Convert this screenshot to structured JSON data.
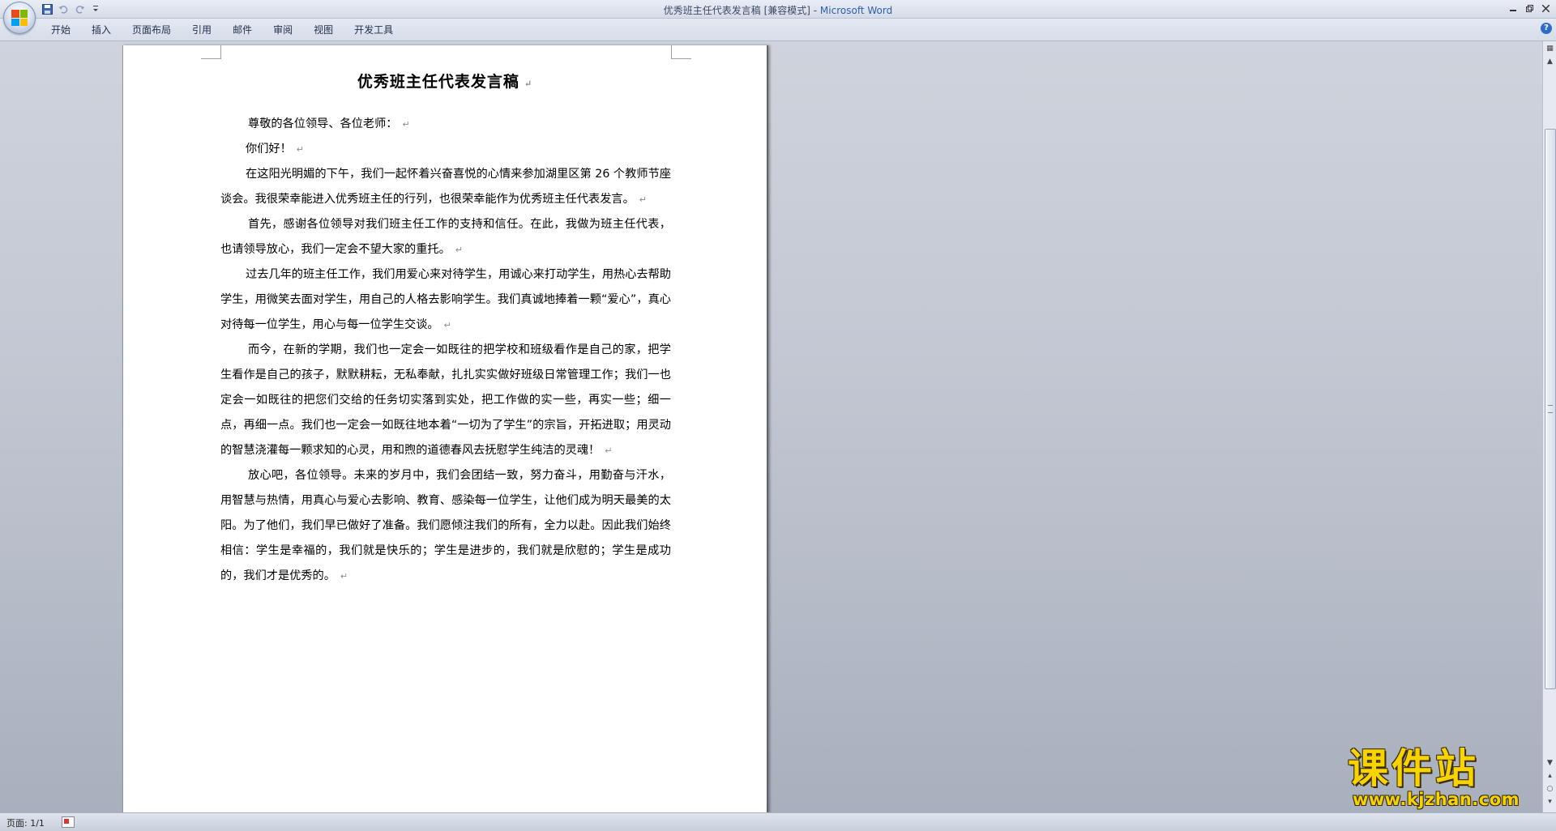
{
  "window": {
    "title_doc": "优秀班主任代表发言稿 [兼容模式] - ",
    "title_app": "Microsoft Word"
  },
  "ribbon": {
    "tabs": [
      "开始",
      "插入",
      "页面布局",
      "引用",
      "邮件",
      "审阅",
      "视图",
      "开发工具"
    ]
  },
  "document": {
    "title": "优秀班主任代表发言稿",
    "paragraphs": [
      "尊敬的各位领导、各位老师：",
      "你们好！",
      "在这阳光明媚的下午，我们一起怀着兴奋喜悦的心情来参加湖里区第 26 个教师节座谈会。我很荣幸能进入优秀班主任的行列，也很荣幸能作为优秀班主任代表发言。",
      "首先，感谢各位领导对我们班主任工作的支持和信任。在此，我做为班主任代表，也请领导放心，我们一定会不望大家的重托。",
      "过去几年的班主任工作，我们用爱心来对待学生，用诚心来打动学生，用热心去帮助学生，用微笑去面对学生，用自己的人格去影响学生。我们真诚地捧着一颗“爱心”，真心对待每一位学生，用心与每一位学生交谈。",
      "而今，在新的学期，我们也一定会一如既往的把学校和班级看作是自己的家，把学生看作是自己的孩子，默默耕耘，无私奉献，扎扎实实做好班级日常管理工作；我们一也定会一如既往的把您们交给的任务切实落到实处，把工作做的实一些，再实一些；细一点，再细一点。我们也一定会一如既往地本着“一切为了学生”的宗旨，开拓进取；用灵动的智慧浇灌每一颗求知的心灵，用和煦的道德春风去抚慰学生纯洁的灵魂！",
      "放心吧，各位领导。未来的岁月中，我们会团结一致，努力奋斗，用勤奋与汗水，用智慧与热情，用真心与爱心去影响、教育、感染每一位学生，让他们成为明天最美的太阳。为了他们，我们早已做好了准备。我们愿倾注我们的所有，全力以赴。因此我们始终相信：学生是幸福的，我们就是快乐的；学生是进步的，我们就是欣慰的；学生是成功的，我们才是优秀的。"
    ],
    "paragraph_mark": "↵"
  },
  "statusbar": {
    "page_count": "页面: 1/1"
  },
  "watermark": {
    "cn": "课件站",
    "url": "www.kjzhan.com"
  },
  "icons": {
    "office_button": "office-logo-icon",
    "save": "save-icon",
    "undo": "undo-icon",
    "redo": "redo-icon",
    "customize": "customize-qat-icon",
    "help": "help-icon"
  },
  "colors": {
    "office_logo": [
      "#e74c1c",
      "#7cbb00",
      "#00a1f1",
      "#ffbb00"
    ],
    "title_brand": "#2b5fb0",
    "watermark": "#f7d300"
  }
}
